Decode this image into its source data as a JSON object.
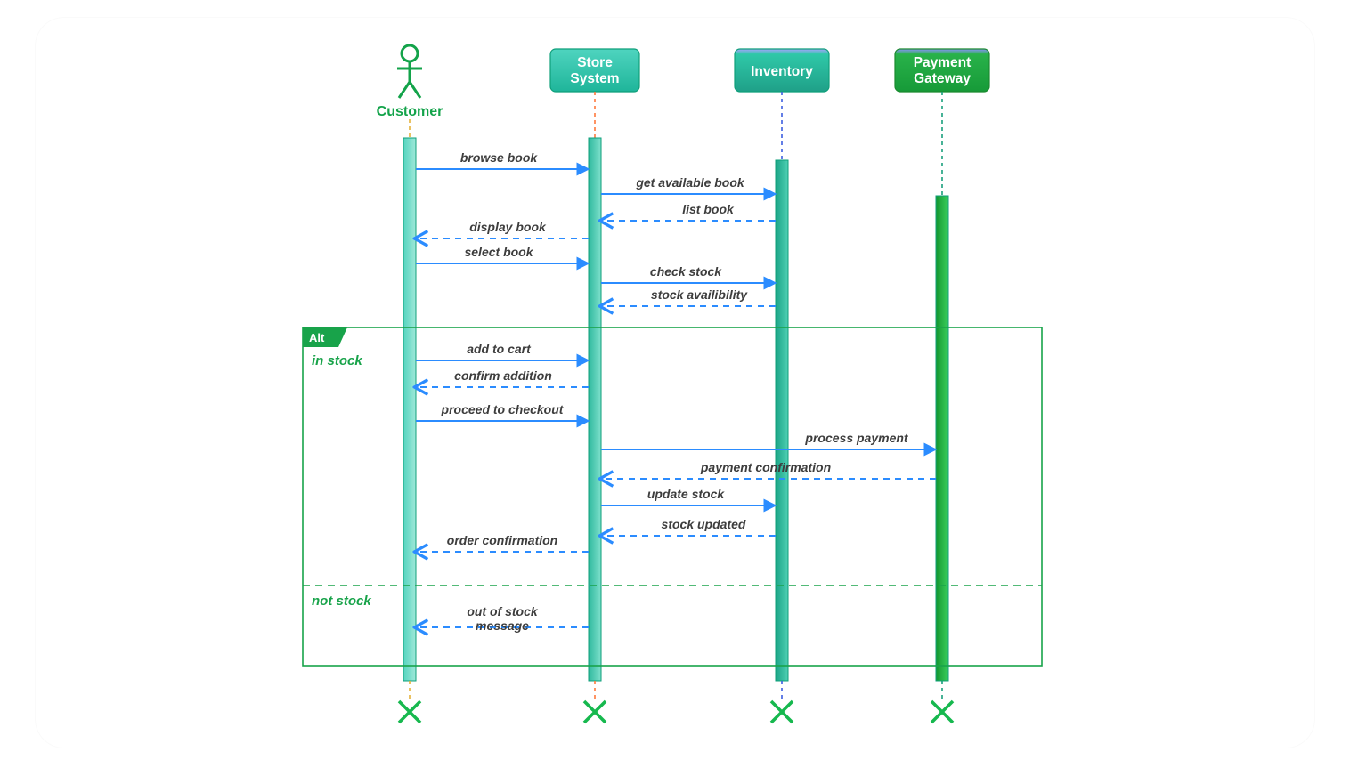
{
  "participants": {
    "customer": {
      "label": "Customer"
    },
    "store": {
      "label1": "Store",
      "label2": "System"
    },
    "inventory": {
      "label": "Inventory"
    },
    "payment": {
      "label1": "Payment",
      "label2": "Gateway"
    }
  },
  "alt": {
    "tag": "Alt",
    "guard_in": "in stock",
    "guard_out": "not stock"
  },
  "messages": {
    "m1": "browse book",
    "m2": "get available book",
    "m3": "list book",
    "m4": "display book",
    "m5": "select book",
    "m6": "check stock",
    "m7": "stock availibility",
    "m8": "add to cart",
    "m9": "confirm addition",
    "m10": "proceed to checkout",
    "m11": "process payment",
    "m12": "payment confirmation",
    "m13": "update stock",
    "m14": "stock updated",
    "m15": "order confirmation",
    "m16a": "out of stock",
    "m16b": "message"
  },
  "chart_data": {
    "type": "uml-sequence",
    "participants": [
      {
        "id": "customer",
        "kind": "actor",
        "name": "Customer"
      },
      {
        "id": "store",
        "kind": "object",
        "name": "Store System"
      },
      {
        "id": "inventory",
        "kind": "object",
        "name": "Inventory"
      },
      {
        "id": "payment",
        "kind": "object",
        "name": "Payment Gateway"
      }
    ],
    "messages": [
      {
        "from": "customer",
        "to": "store",
        "label": "browse book",
        "kind": "sync"
      },
      {
        "from": "store",
        "to": "inventory",
        "label": "get available book",
        "kind": "sync"
      },
      {
        "from": "inventory",
        "to": "store",
        "label": "list book",
        "kind": "return"
      },
      {
        "from": "store",
        "to": "customer",
        "label": "display book",
        "kind": "return"
      },
      {
        "from": "customer",
        "to": "store",
        "label": "select book",
        "kind": "sync"
      },
      {
        "from": "store",
        "to": "inventory",
        "label": "check stock",
        "kind": "sync"
      },
      {
        "from": "inventory",
        "to": "store",
        "label": "stock availibility",
        "kind": "return"
      }
    ],
    "fragments": [
      {
        "type": "alt",
        "operands": [
          {
            "guard": "in stock",
            "messages": [
              {
                "from": "customer",
                "to": "store",
                "label": "add to cart",
                "kind": "sync"
              },
              {
                "from": "store",
                "to": "customer",
                "label": "confirm addition",
                "kind": "return"
              },
              {
                "from": "customer",
                "to": "store",
                "label": "proceed to checkout",
                "kind": "sync"
              },
              {
                "from": "store",
                "to": "payment",
                "label": "process payment",
                "kind": "sync"
              },
              {
                "from": "payment",
                "to": "store",
                "label": "payment confirmation",
                "kind": "return"
              },
              {
                "from": "store",
                "to": "inventory",
                "label": "update stock",
                "kind": "sync"
              },
              {
                "from": "inventory",
                "to": "store",
                "label": "stock updated",
                "kind": "return"
              },
              {
                "from": "store",
                "to": "customer",
                "label": "order confirmation",
                "kind": "return"
              }
            ]
          },
          {
            "guard": "not stock",
            "messages": [
              {
                "from": "store",
                "to": "customer",
                "label": "out of stock message",
                "kind": "return"
              }
            ]
          }
        ]
      }
    ],
    "terminations": [
      "customer",
      "store",
      "inventory",
      "payment"
    ]
  }
}
